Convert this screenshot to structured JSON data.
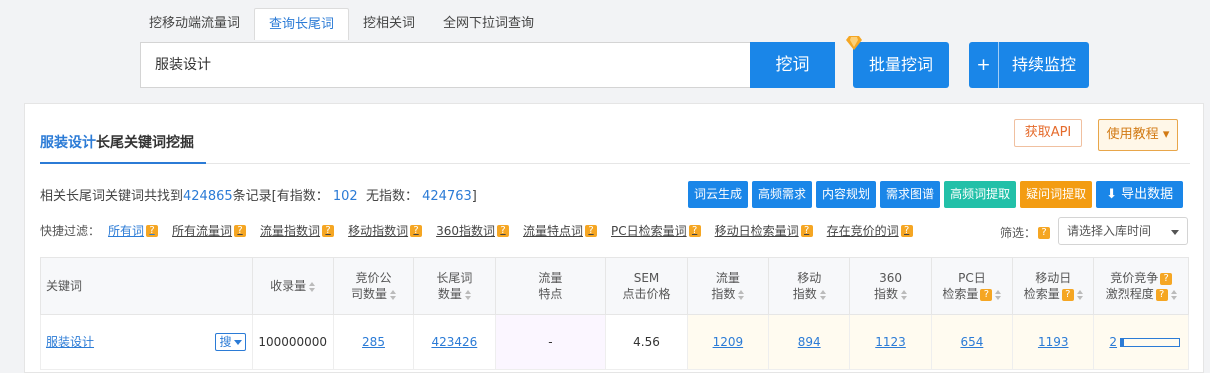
{
  "tabs": [
    {
      "label": "挖移动端流量词",
      "active": false
    },
    {
      "label": "查询长尾词",
      "active": true
    },
    {
      "label": "挖相关词",
      "active": false
    },
    {
      "label": "全网下拉词查询",
      "active": false
    }
  ],
  "search": {
    "value": "服装设计",
    "dig_label": "挖词",
    "batch_label": "批量挖词",
    "monitor_plus": "+",
    "monitor_label": "持续监控"
  },
  "panel": {
    "title_keyword": "服装设计",
    "title_suffix": "长尾关键词挖掘",
    "api_label": "获取API",
    "tutorial_label": "使用教程",
    "summary_prefix": "相关长尾词关键词共找到",
    "summary_count": "424865",
    "summary_mid": "条记录[有指数：",
    "summary_with_index": "102",
    "summary_mid2": "无指数：",
    "summary_without_index": "424763",
    "summary_end": "]"
  },
  "actions": [
    {
      "label": "词云生成",
      "color": "blue"
    },
    {
      "label": "高频需求",
      "color": "blue"
    },
    {
      "label": "内容规划",
      "color": "blue"
    },
    {
      "label": "需求图谱",
      "color": "blue"
    },
    {
      "label": "高频词提取",
      "color": "teal"
    },
    {
      "label": "疑问词提取",
      "color": "orange"
    }
  ],
  "export_label": "导出数据",
  "filters": {
    "label": "快捷过滤：",
    "items": [
      {
        "label": "所有词",
        "active": true
      },
      {
        "label": "所有流量词",
        "active": false
      },
      {
        "label": "流量指数词",
        "active": false
      },
      {
        "label": "移动指数词",
        "active": false
      },
      {
        "label": "360指数词",
        "active": false
      },
      {
        "label": "流量特点词",
        "active": false
      },
      {
        "label": "PC日检索量词",
        "active": false
      },
      {
        "label": "移动日检索量词",
        "active": false
      },
      {
        "label": "存在竞价的词",
        "active": false
      }
    ],
    "screen_label": "筛选：",
    "date_placeholder": "请选择入库时间"
  },
  "table": {
    "headers": {
      "keyword": "关键词",
      "indexed": "收录量",
      "bid_companies_1": "竞价公",
      "bid_companies_2": "司数量",
      "longtail_1": "长尾词",
      "longtail_2": "数量",
      "traffic_feat_1": "流量",
      "traffic_feat_2": "特点",
      "sem_1": "SEM",
      "sem_2": "点击价格",
      "traffic_idx_1": "流量",
      "traffic_idx_2": "指数",
      "mobile_idx_1": "移动",
      "mobile_idx_2": "指数",
      "idx360_1": "360",
      "idx360_2": "指数",
      "pc_daily_1": "PC日",
      "pc_daily_2": "检索量",
      "mobile_daily_1": "移动日",
      "mobile_daily_2": "检索量",
      "competition_1": "竞价竞争",
      "competition_2": "激烈程度"
    },
    "rows": [
      {
        "keyword": "服装设计",
        "search_btn": "搜",
        "indexed": "100000000",
        "bid_companies": "285",
        "longtail": "423426",
        "traffic_feat": "-",
        "sem": "4.56",
        "traffic_idx": "1209",
        "mobile_idx": "894",
        "idx360": "1123",
        "pc_daily": "654",
        "mobile_daily": "1193",
        "competition": "2",
        "competition_level": 0.05
      }
    ]
  },
  "colors": {
    "primary": "#1a86e8",
    "teal": "#22c0a8",
    "orange": "#f39c12",
    "help": "#f5a623"
  }
}
